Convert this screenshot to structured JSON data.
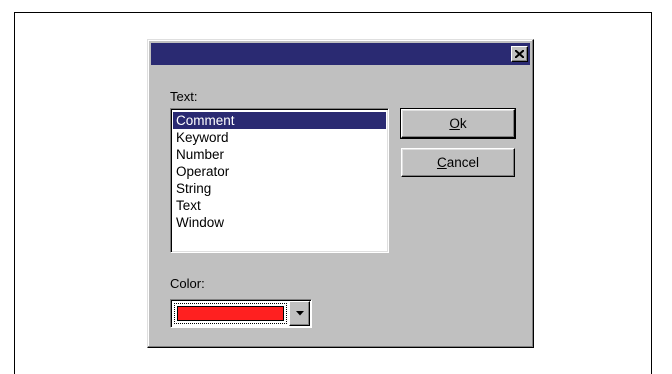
{
  "dialog": {
    "close_icon": "close-x-icon",
    "text_label": "Text:",
    "list_items": [
      "Comment",
      "Keyword",
      "Number",
      "Operator",
      "String",
      "Text",
      "Window"
    ],
    "selected_item": "Comment",
    "ok_button": {
      "mnemonic": "O",
      "rest": "k"
    },
    "cancel_button": {
      "mnemonic": "C",
      "rest": "ancel"
    },
    "color_label": "Color:",
    "color_value": "#ff2020",
    "dropdown_icon": "chevron-down-icon",
    "titlebar_color": "#2a2a72"
  }
}
